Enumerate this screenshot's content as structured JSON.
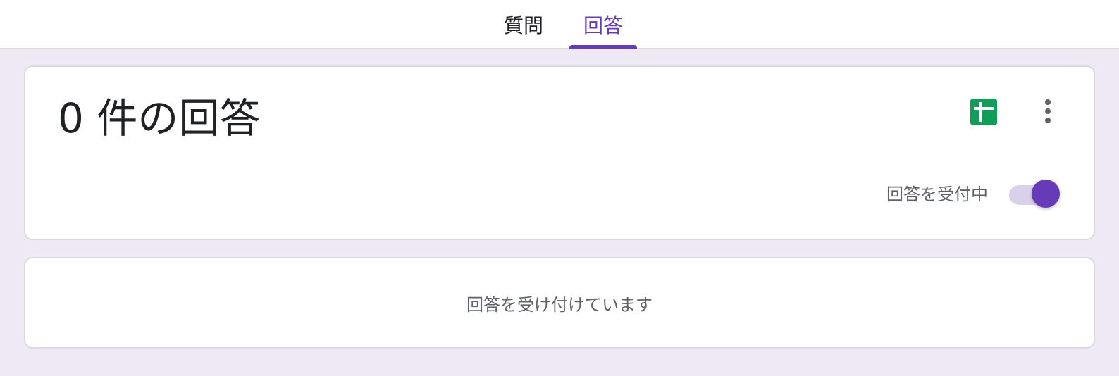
{
  "tabs": [
    {
      "label": "質問",
      "active": false
    },
    {
      "label": "回答",
      "active": true
    }
  ],
  "summary": {
    "count_title": "0 件の回答",
    "sheets_icon": "google-sheets-icon",
    "more_icon": "more-vert-icon",
    "accepting_label": "回答を受付中",
    "accepting_on": true
  },
  "status": {
    "message": "回答を受け付けています"
  },
  "colors": {
    "accent": "#673ab7",
    "sheets_green": "#0f9d58",
    "background": "#efe9f6"
  }
}
